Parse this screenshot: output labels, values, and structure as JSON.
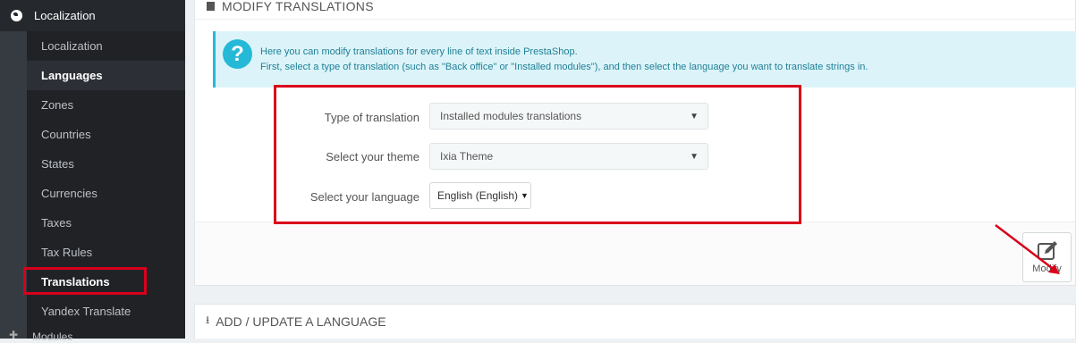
{
  "sidebar": {
    "section_label": "Localization",
    "items": [
      {
        "label": "Localization"
      },
      {
        "label": "Languages"
      },
      {
        "label": "Zones"
      },
      {
        "label": "Countries"
      },
      {
        "label": "States"
      },
      {
        "label": "Currencies"
      },
      {
        "label": "Taxes"
      },
      {
        "label": "Tax Rules"
      },
      {
        "label": "Translations"
      },
      {
        "label": "Yandex Translate"
      }
    ],
    "bottom_label": "Modules"
  },
  "panel": {
    "title": "MODIFY TRANSLATIONS",
    "alert_line1": "Here you can modify translations for every line of text inside PrestaShop.",
    "alert_line2": "First, select a type of translation (such as \"Back office\" or \"Installed modules\"), and then select the language you want to translate strings in.",
    "type_label": "Type of translation",
    "type_value": "Installed modules translations",
    "theme_label": "Select your theme",
    "theme_value": "Ixia Theme",
    "language_label": "Select your language",
    "language_value": "English (English)",
    "modify_label": "Modify"
  },
  "panel2": {
    "title": "ADD / UPDATE A LANGUAGE"
  },
  "colors": {
    "sidebar_bg": "#363a41",
    "accent": "#25b9d7",
    "highlight_red": "#d9001b"
  }
}
